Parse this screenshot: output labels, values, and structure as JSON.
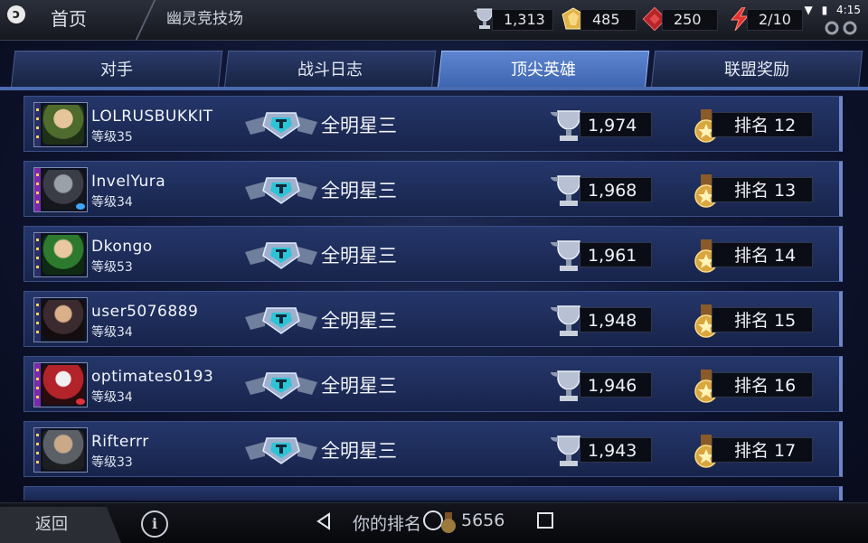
{
  "status_bar": {
    "time": "4:15"
  },
  "header": {
    "home_label": "首页",
    "page_title": "幽灵竞技场",
    "resources": [
      {
        "icon": "trophy-icon",
        "value": "1,313"
      },
      {
        "icon": "gold-crystal-icon",
        "value": "485"
      },
      {
        "icon": "ruby-icon",
        "value": "250"
      },
      {
        "icon": "energy-bolt-icon",
        "value": "2/10"
      }
    ]
  },
  "tabs": [
    {
      "label": "对手",
      "active": false
    },
    {
      "label": "战斗日志",
      "active": false
    },
    {
      "label": "顶尖英雄",
      "active": true
    },
    {
      "label": "联盟奖励",
      "active": false
    }
  ],
  "leaderboard": {
    "rows": [
      {
        "name": "LOLRUSBUKKIT",
        "level": "等级35",
        "league": "全明星三",
        "trophies": "1,974",
        "rank": "排名 12"
      },
      {
        "name": "InvelYura",
        "level": "等级34",
        "league": "全明星三",
        "trophies": "1,968",
        "rank": "排名 13"
      },
      {
        "name": "Dkongo",
        "level": "等级53",
        "league": "全明星三",
        "trophies": "1,961",
        "rank": "排名 14"
      },
      {
        "name": "user5076889",
        "level": "等级34",
        "league": "全明星三",
        "trophies": "1,948",
        "rank": "排名 15"
      },
      {
        "name": "optimates0193",
        "level": "等级34",
        "league": "全明星三",
        "trophies": "1,946",
        "rank": "排名 16"
      },
      {
        "name": "Rifterrr",
        "level": "等级33",
        "league": "全明星三",
        "trophies": "1,943",
        "rank": "排名 17"
      }
    ]
  },
  "footer": {
    "back_label": "返回",
    "info_label": "i",
    "my_rank_label": "你的排名",
    "my_rank_value": "5656"
  },
  "colors": {
    "accent": "#5e86d0",
    "row_background": "#1e2d5a",
    "medal_gold": "#d9a640"
  }
}
